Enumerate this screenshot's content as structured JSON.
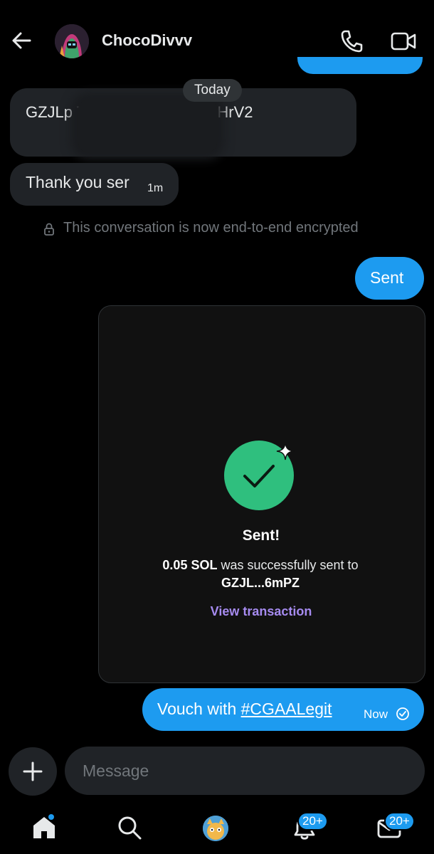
{
  "header": {
    "contact_name": "ChocoDivvv"
  },
  "conversation": {
    "date_chip": "Today",
    "address_message": "GZJLp                  TSCM38FYVWffdTyHrV2",
    "thanks_message": "Thank you ser",
    "thanks_time": "1m",
    "encryption_notice": "This conversation is now end-to-end encrypted",
    "sent_message": "Sent",
    "card": {
      "title": "Sent!",
      "amount": "0.05 SOL",
      "description_rest": "was successfully sent to",
      "recipient": "GZJL...6mPZ",
      "link": "View transaction"
    },
    "vouch_prefix": "Vouch with ",
    "vouch_hashtag": "#CGAALegit",
    "vouch_time": "Now"
  },
  "composer": {
    "placeholder": "Message"
  },
  "nav": {
    "notifications_badge": "20+",
    "messages_badge": "20+"
  },
  "colors": {
    "accent": "#1d9bf0",
    "success": "#2fbf7e",
    "link": "#a68bf0",
    "bubble_in": "#202327"
  },
  "icons": [
    "back-arrow-icon",
    "phone-icon",
    "video-icon",
    "lock-icon",
    "check-icon",
    "sparkle-icon",
    "read-receipt-icon",
    "plus-icon",
    "home-icon",
    "search-icon",
    "bell-icon",
    "mail-icon"
  ]
}
